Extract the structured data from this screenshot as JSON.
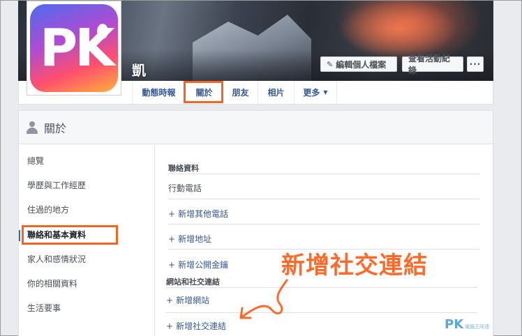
{
  "profile": {
    "name": "凱",
    "logo_text": "PK"
  },
  "cover_buttons": {
    "edit": "編輯個人檔案",
    "activity_log": "查看活動紀錄",
    "more": "···"
  },
  "nav": {
    "timeline": "動態時報",
    "about": "關於",
    "friends": "朋友",
    "photos": "相片",
    "more": "更多"
  },
  "about": {
    "title": "關於",
    "sidebar": [
      "總覽",
      "學歷與工作經歷",
      "住過的地方",
      "聯絡和基本資料",
      "家人和感情狀況",
      "你的相關資料",
      "生活要事"
    ],
    "contact": {
      "title": "聯絡資料",
      "mobile": "行動電話",
      "add_phone": "新增其他電話",
      "add_address": "新增地址",
      "add_public_key": "新增公開金鑰"
    },
    "websites": {
      "title": "網站和社交連結",
      "add_website": "新增網站",
      "add_social": "新增社交連結"
    }
  },
  "annotation": "新增社交連結",
  "watermark": {
    "main": "PK",
    "sub": "電腦王阿達"
  },
  "colors": {
    "accent": "#f26522",
    "link": "#365899",
    "annotation": "#ff6a2a"
  }
}
